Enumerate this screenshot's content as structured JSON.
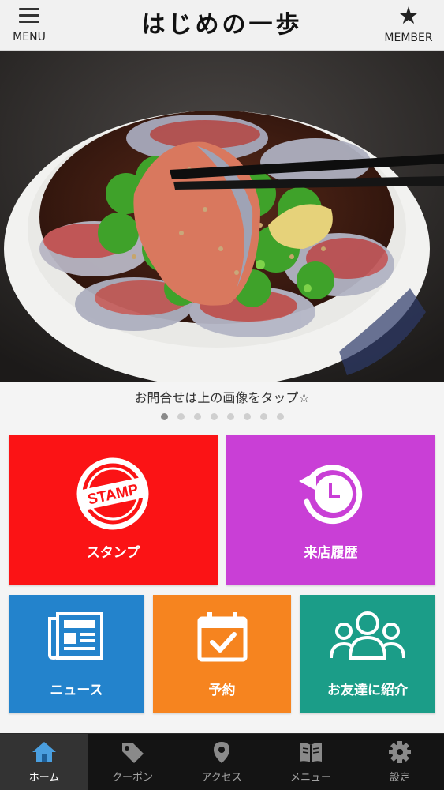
{
  "header": {
    "menu_label": "MENU",
    "title": "はじめの一歩",
    "member_label": "MEMBER"
  },
  "hero": {
    "caption": "お問合せは上の画像をタップ☆",
    "slide_count": 8,
    "active_slide": 1
  },
  "tiles": {
    "stamp": {
      "label": "スタンプ",
      "icon_text": "STAMP",
      "color": "#fb1315"
    },
    "history": {
      "label": "来店履歴",
      "color": "#c93fd6"
    },
    "news": {
      "label": "ニュース",
      "color": "#2383cc"
    },
    "reserve": {
      "label": "予約",
      "color": "#f6841f"
    },
    "friend": {
      "label": "お友達に紹介",
      "color": "#1b9d88"
    }
  },
  "nav": {
    "home": "ホーム",
    "coupon": "クーポン",
    "access": "アクセス",
    "menu": "メニュー",
    "settings": "設定"
  },
  "colors": {
    "active_nav_icon": "#4a9fe0",
    "nav_bg": "#141414"
  }
}
